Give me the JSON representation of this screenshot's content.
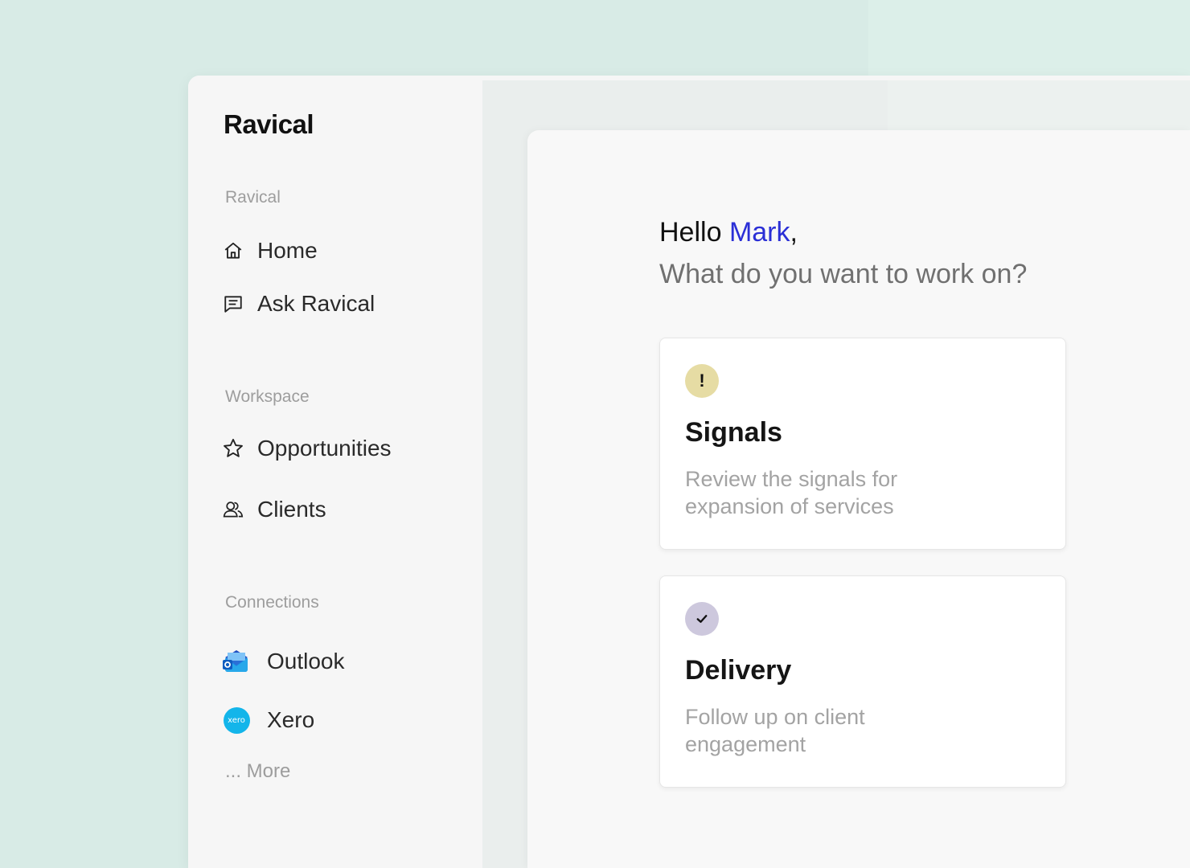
{
  "app": {
    "logo": "Ravical"
  },
  "sidebar": {
    "sections": [
      {
        "label": "Ravical"
      },
      {
        "label": "Workspace"
      },
      {
        "label": "Connections"
      }
    ],
    "ravical_items": [
      {
        "label": "Home",
        "icon": "home-icon"
      },
      {
        "label": "Ask Ravical",
        "icon": "chat-icon"
      }
    ],
    "workspace_items": [
      {
        "label": "Opportunities",
        "icon": "star-icon"
      },
      {
        "label": "Clients",
        "icon": "users-icon"
      }
    ],
    "connections": [
      {
        "label": "Outlook",
        "icon": "outlook-icon"
      },
      {
        "label": "Xero",
        "icon": "xero-icon",
        "icon_text": "xero"
      }
    ],
    "more_label": "... More"
  },
  "main": {
    "greeting_prefix": "Hello ",
    "user_name": "Mark",
    "greeting_suffix": ",",
    "question": "What do you want to work on?",
    "cards": [
      {
        "title": "Signals",
        "description": "Review the signals for expansion of services",
        "badge_symbol": "!",
        "badge_color": "#e6dca4"
      },
      {
        "title": "Delivery",
        "description": "Follow up on client engagement",
        "badge_symbol": "✓",
        "badge_color": "#cdc8dd"
      }
    ]
  },
  "colors": {
    "accent_name": "#2b2fd6",
    "background": "#d8ebe6"
  }
}
